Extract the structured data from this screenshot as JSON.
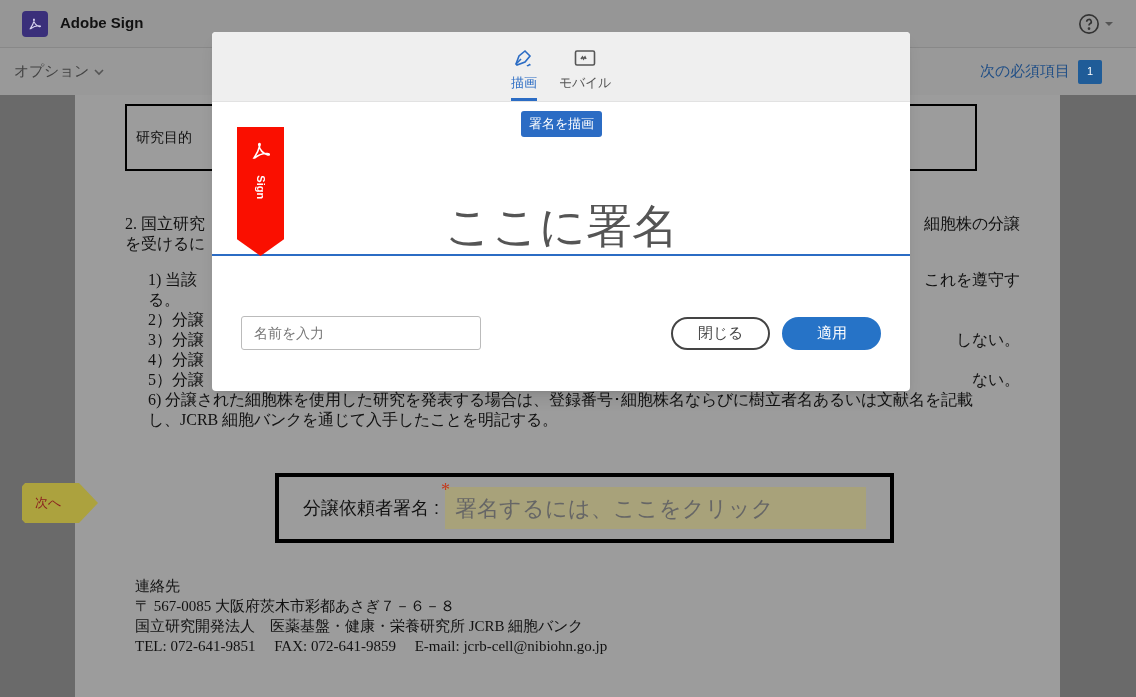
{
  "app_bar": {
    "title": "Adobe Sign"
  },
  "toolbar": {
    "options_menu": "オプション",
    "next_required": "次の必須項目",
    "next_required_count": "1"
  },
  "document": {
    "purpose_box": "研究目的",
    "paragraph": [
      {
        "left": "2. 国立研究",
        "right": "細胞株の分譲"
      },
      {
        "left": "を受けるに"
      }
    ],
    "items": [
      {
        "left": "1) 当該",
        "right": "これを遵守す"
      },
      {
        "left": "る。"
      },
      {
        "left": "2）分譲"
      },
      {
        "left": "3）分譲",
        "right": "しない。"
      },
      {
        "left": "4）分譲"
      },
      {
        "left": "5）分譲",
        "right": "ない。"
      },
      {
        "left": "6) 分譲された細胞株を使用した研究を発表する場合は、登録番号･細胞株名ならびに樹立者名あるいは文献名を記載"
      },
      {
        "left": "し、JCRB 細胞バンクを通じて入手したことを明記する。"
      }
    ],
    "next_tag": "次へ",
    "signature_label": "分譲依頼者署名 :",
    "required_mark": "*",
    "signature_placeholder": "署名するには、ここをクリック",
    "contact": [
      "連絡先",
      "〒 567-0085 大阪府茨木市彩都あさぎ７－６－８",
      "国立研究開発法人　医薬基盤・健康・栄養研究所 JCRB 細胞バンク",
      "TEL: 072-641-9851　 FAX: 072-641-9859　 E-mail: jcrb-cell@nibiohn.go.jp"
    ]
  },
  "dialog": {
    "tabs": [
      {
        "label": "描画",
        "kind": "draw",
        "selected": true
      },
      {
        "label": "モバイル",
        "kind": "mobile",
        "selected": false
      }
    ],
    "tooltip": "署名を描画",
    "ribbon_label": "Sign",
    "signature_hint": "ここに署名",
    "name_field": {
      "placeholder": "名前を入力"
    },
    "buttons": [
      {
        "label": "閉じる",
        "kind": "secondary"
      },
      {
        "label": "適用",
        "kind": "primary"
      }
    ]
  }
}
